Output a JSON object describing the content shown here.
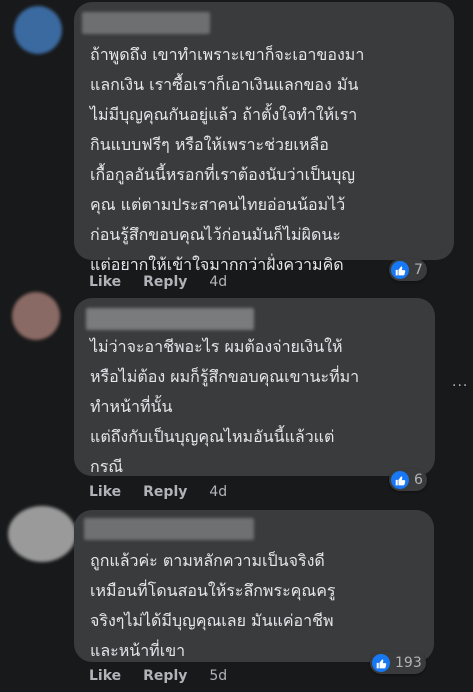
{
  "comments": [
    {
      "name": "",
      "text": "ถ้าพูดถึง เขาทำเพราะเขาก็จะเอาของมา\nแลกเงิน เราซื้อเราก็เอาเงินแลกของ มัน\nไม่มีบุญคุณกันอยู่แล้ว ถ้าตั้งใจทำให้เรา\nกินแบบฟรีๆ หรือให้เพราะช่วยเหลือ\nเกื้อกูลอันนี้หรอกที่เราต้องนับว่าเป็นบุญ\nคุณ แต่ตามประสาคนไทยอ่อนน้อมไว้\nก่อนรู้สึกขอบคุณไว้ก่อนมันก็ไม่ผิดนะ\nแต่อยากให้เข้าใจมากกว่าฝั่งความคิด",
      "like_label": "Like",
      "reply_label": "Reply",
      "time": "4d",
      "reaction_count": "7",
      "avatar_color": "#3b6aa0"
    },
    {
      "name": "",
      "text": "ไม่ว่าจะอาชีพอะไร ผมต้องจ่ายเงินให้\nหรือไม่ต้อง ผมก็รู้สึกขอบคุณเขานะที่มา\nทำหน้าที่นั้น\nแต่ถึงกับเป็นบุญคุณไหมอันนี้แล้วแต่\nกรณี",
      "like_label": "Like",
      "reply_label": "Reply",
      "time": "4d",
      "reaction_count": "6",
      "avatar_color": "#8a6a64"
    },
    {
      "name": "",
      "text": "ถูกแล้วค่ะ ตามหลักความเป็นจริงดี\nเหมือนที่โดนสอนให้ระลึกพระคุณครู\nจริงๆไม่ได้มีบุญคุณเลย มันแค่อาชีพ\nและหน้าที่เขา",
      "like_label": "Like",
      "reply_label": "Reply",
      "time": "5d",
      "reaction_count": "193",
      "avatar_color": "#9a9a9a"
    }
  ],
  "colors": {
    "background": "#18191a",
    "bubble": "#3a3b3c",
    "text": "#e4e6eb",
    "secondary_text": "#b0b3b8",
    "like_blue": "#1877f2"
  },
  "icons": {
    "reaction": "thumbs-up-icon",
    "more": "more-options-icon"
  },
  "more_options": "···"
}
